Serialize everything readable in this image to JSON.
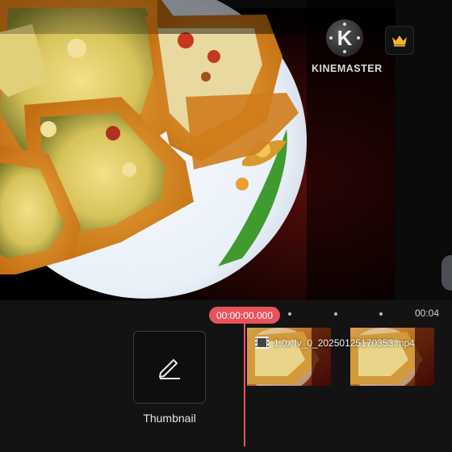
{
  "preview": {
    "watermark": {
      "brand_text": "KINEMASTER",
      "logo_letter": "K"
    },
    "premium_icon": "crown-icon"
  },
  "timeline": {
    "playhead_time": "00:00:00.000",
    "ruler_end_label": "00:04",
    "thumbnail": {
      "label": "Thumbnail",
      "icon": "pen-icon"
    },
    "clip": {
      "label": "1.0x lv_0_20250125170353.mp4",
      "icon": "film-icon"
    }
  },
  "colors": {
    "accent": "#e8525a",
    "panel": "#131313",
    "premium": "#f5b335"
  }
}
